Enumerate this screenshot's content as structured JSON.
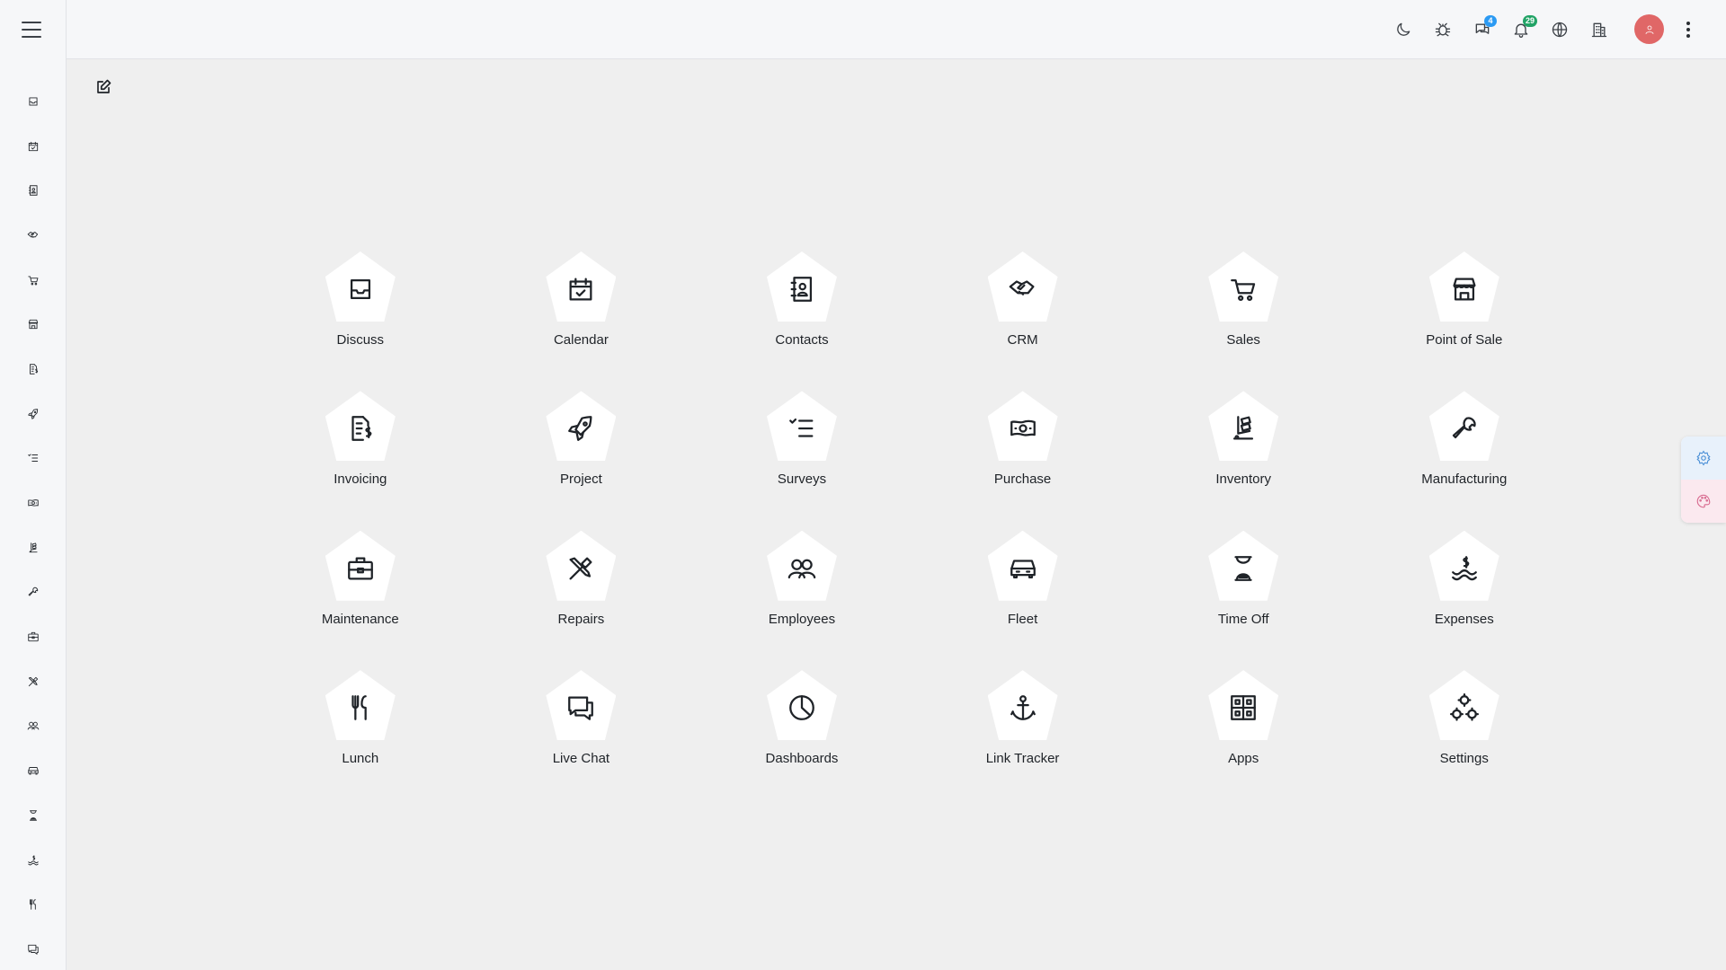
{
  "topbar": {
    "icons": [
      {
        "name": "dark-mode-icon"
      },
      {
        "name": "debug-icon"
      },
      {
        "name": "messages-icon",
        "badge": "4",
        "badge_color": "#2b9af3"
      },
      {
        "name": "notifications-icon",
        "badge": "29",
        "badge_color": "#21a366"
      },
      {
        "name": "language-icon"
      },
      {
        "name": "company-icon"
      }
    ],
    "avatar_color": "#e06767"
  },
  "sidebar": {
    "items": [
      {
        "icon": "discuss-icon"
      },
      {
        "icon": "calendar-icon"
      },
      {
        "icon": "contacts-icon"
      },
      {
        "icon": "crm-icon"
      },
      {
        "icon": "sales-icon"
      },
      {
        "icon": "point-of-sale-icon"
      },
      {
        "icon": "invoicing-icon"
      },
      {
        "icon": "project-icon"
      },
      {
        "icon": "surveys-icon"
      },
      {
        "icon": "purchase-icon"
      },
      {
        "icon": "inventory-icon"
      },
      {
        "icon": "manufacturing-icon"
      },
      {
        "icon": "maintenance-icon"
      },
      {
        "icon": "repairs-icon"
      },
      {
        "icon": "employees-icon"
      },
      {
        "icon": "fleet-icon"
      },
      {
        "icon": "time-off-icon"
      },
      {
        "icon": "expenses-icon"
      },
      {
        "icon": "lunch-icon"
      },
      {
        "icon": "live-chat-icon"
      }
    ]
  },
  "apps": [
    {
      "label": "Discuss",
      "icon": "discuss-icon"
    },
    {
      "label": "Calendar",
      "icon": "calendar-icon"
    },
    {
      "label": "Contacts",
      "icon": "contacts-icon"
    },
    {
      "label": "CRM",
      "icon": "crm-icon"
    },
    {
      "label": "Sales",
      "icon": "sales-icon"
    },
    {
      "label": "Point of Sale",
      "icon": "point-of-sale-icon"
    },
    {
      "label": "Invoicing",
      "icon": "invoicing-icon"
    },
    {
      "label": "Project",
      "icon": "project-icon"
    },
    {
      "label": "Surveys",
      "icon": "surveys-icon"
    },
    {
      "label": "Purchase",
      "icon": "purchase-icon"
    },
    {
      "label": "Inventory",
      "icon": "inventory-icon"
    },
    {
      "label": "Manufacturing",
      "icon": "manufacturing-icon"
    },
    {
      "label": "Maintenance",
      "icon": "maintenance-icon"
    },
    {
      "label": "Repairs",
      "icon": "repairs-icon"
    },
    {
      "label": "Employees",
      "icon": "employees-icon"
    },
    {
      "label": "Fleet",
      "icon": "fleet-icon"
    },
    {
      "label": "Time Off",
      "icon": "time-off-icon"
    },
    {
      "label": "Expenses",
      "icon": "expenses-icon"
    },
    {
      "label": "Lunch",
      "icon": "lunch-icon"
    },
    {
      "label": "Live Chat",
      "icon": "live-chat-icon"
    },
    {
      "label": "Dashboards",
      "icon": "dashboards-icon"
    },
    {
      "label": "Link Tracker",
      "icon": "link-tracker-icon"
    },
    {
      "label": "Apps",
      "icon": "apps-icon"
    },
    {
      "label": "Settings",
      "icon": "settings-icon"
    }
  ],
  "float_panel": {
    "settings_color": "#4a8fd6",
    "theme_color": "#d86a8f"
  }
}
